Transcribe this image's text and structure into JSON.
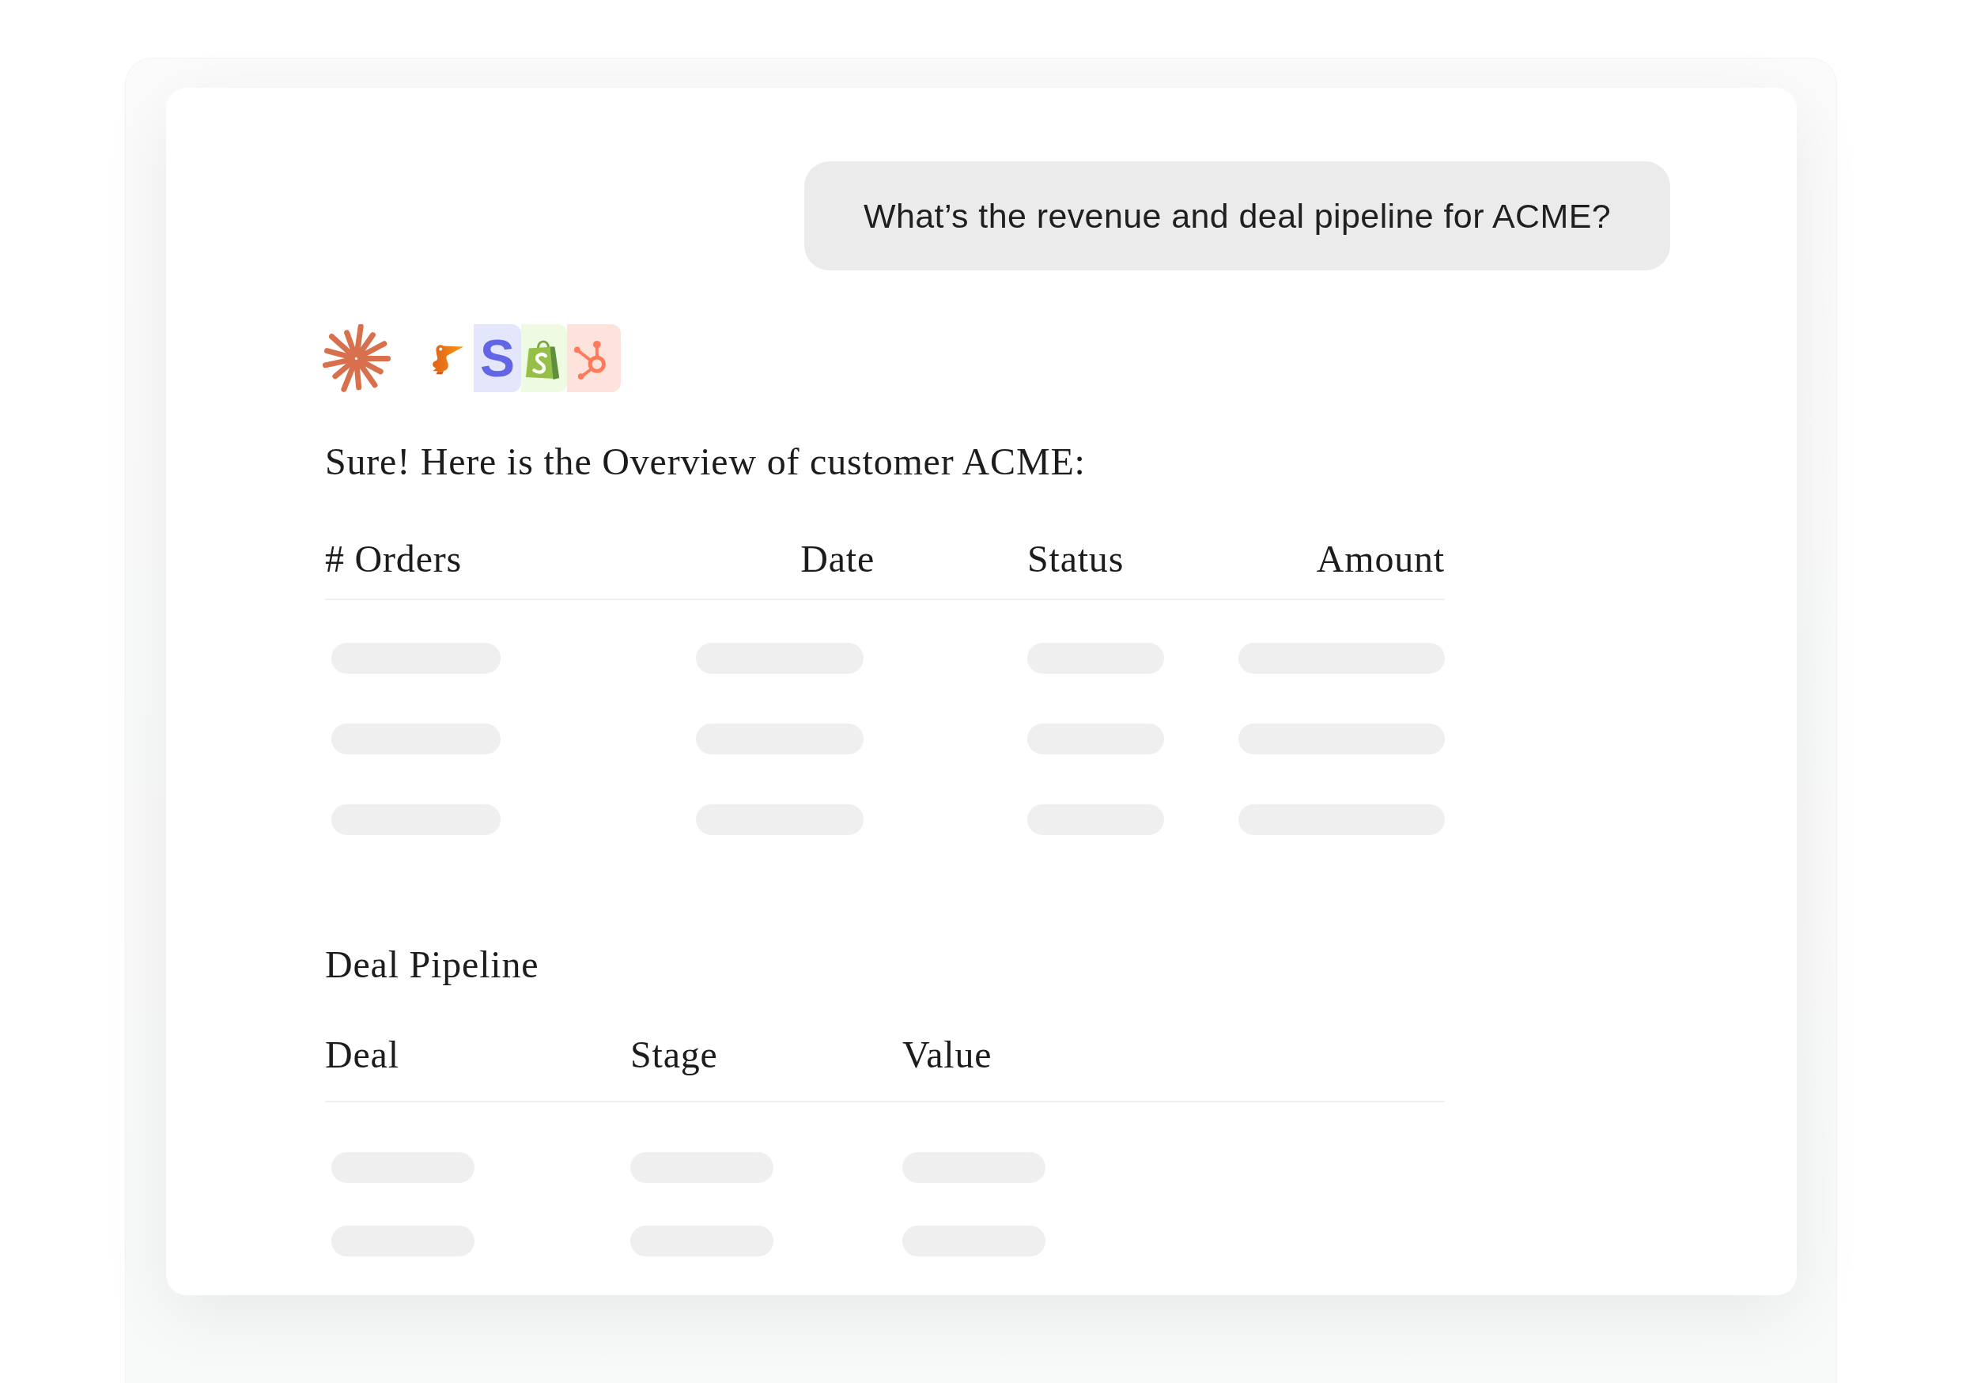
{
  "chat": {
    "user_message": "What’s the revenue and deal pipeline for ACME?",
    "sources": [
      {
        "kind": "bird",
        "color": "#ffffff"
      },
      {
        "kind": "letter",
        "glyph": "S",
        "color": "#e4e6fc"
      },
      {
        "kind": "bag",
        "color": "#eefbe2"
      },
      {
        "kind": "hub",
        "color": "#fde3dc"
      }
    ],
    "reply": "Sure! Here is the Overview of customer ACME:",
    "orders_table": {
      "columns": [
        "# Orders",
        "Date",
        "Status",
        "Amount"
      ],
      "rows": [
        {
          "loading": true
        },
        {
          "loading": true
        },
        {
          "loading": true
        }
      ]
    },
    "pipeline": {
      "title": "Deal Pipeline",
      "columns": [
        "Deal",
        "Stage",
        "Value"
      ],
      "rows": [
        {
          "loading": true
        },
        {
          "loading": true
        }
      ]
    }
  }
}
